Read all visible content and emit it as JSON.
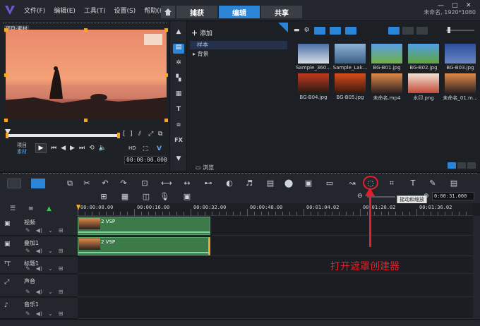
{
  "menu": [
    "文件(F)",
    "编辑(E)",
    "工具(T)",
    "设置(S)",
    "帮助(H)"
  ],
  "tabs": {
    "capture": "捕获",
    "edit": "编辑",
    "share": "共享"
  },
  "project_info": "未命名, 1920*1080",
  "preview": {
    "clip_label": "项目-素材",
    "mode_project": "项目",
    "mode_clip": "素材",
    "timecode": "00:00:00.000",
    "v_label": "V"
  },
  "library": {
    "add_label": "添加",
    "folders": [
      "样本",
      "背景"
    ],
    "browse_label": "浏览",
    "thumbnails": [
      {
        "label": "Sample_360...",
        "color_top": "#4a6fa5",
        "color_bottom": "#d8dde4"
      },
      {
        "label": "Sample_Lak...",
        "color_top": "#8fb2d6",
        "color_bottom": "#3a5f86"
      },
      {
        "label": "BG-B01.jpg",
        "color_top": "#5aa0e6",
        "color_bottom": "#6fb043"
      },
      {
        "label": "BG-B02.jpg",
        "color_top": "#4f9fe8",
        "color_bottom": "#5fa53b"
      },
      {
        "label": "BG-B03.jpg",
        "color_top": "#2d4f9c",
        "color_bottom": "#6a87c4"
      },
      {
        "label": "BG-B04.jpg",
        "color_top": "#c23a1e",
        "color_bottom": "#2a1a14"
      },
      {
        "label": "BG-B05.jpg",
        "color_top": "#d94c1a",
        "color_bottom": "#3a1810"
      },
      {
        "label": "未命名.mp4",
        "color_top": "#e08a4a",
        "color_bottom": "#2e2220"
      },
      {
        "label": "水印.png",
        "color_top": "#f2e2d2",
        "color_bottom": "#c44a3a"
      },
      {
        "label": "未命名_01.m...",
        "color_top": "#e08a4a",
        "color_bottom": "#2e2220"
      }
    ]
  },
  "timeline": {
    "tooltip": "摇动和缩放",
    "timecode": "0:00:31.000",
    "ruler": [
      "00:00:00.00",
      "00:00:16.00",
      "00:00:32.00",
      "00:00:48.00",
      "00:01:04.02",
      "00:01:20.02",
      "00:01:36.02"
    ],
    "tracks": [
      {
        "name": "视频",
        "icon": "video-track-icon"
      },
      {
        "name": "叠加1",
        "icon": "overlay-track-icon"
      },
      {
        "name": "标题1",
        "icon": "title-track-icon"
      },
      {
        "name": "声音",
        "icon": "voice-track-icon"
      },
      {
        "name": "音乐1",
        "icon": "music-track-icon"
      }
    ],
    "clips": [
      {
        "label": "2 VSP",
        "track": 0
      },
      {
        "label": "2 VSP",
        "track": 1
      }
    ]
  },
  "annotation": "打开遮罩创建器",
  "colors": {
    "accent": "#2c84d6",
    "highlight": "#e0202a",
    "clip": "#3d7a4a"
  }
}
